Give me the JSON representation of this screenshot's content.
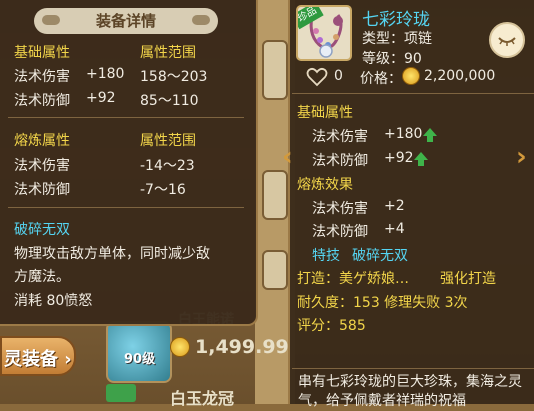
{
  "background": {
    "spirit_equip_button": "灵装备",
    "item_level": "90级",
    "item_price": "1,499.99",
    "item_name_partial": "白王能诺",
    "item_name2_partial": "白玉龙冠"
  },
  "left_panel": {
    "title": "装备详情",
    "base_header": "基础属性",
    "base_range_header": "属性范围",
    "base_attrs": [
      {
        "name": "法术伤害",
        "value": "+180",
        "range": "158～203"
      },
      {
        "name": "法术防御",
        "value": "+92",
        "range": "85～110"
      }
    ],
    "refine_header": "熔炼属性",
    "refine_range_header": "属性范围",
    "refine_attrs": [
      {
        "name": "法术伤害",
        "range": "-14～23"
      },
      {
        "name": "法术防御",
        "range": "-7～16"
      }
    ],
    "skill_name": "破碎无双",
    "skill_desc_line1": "物理攻击敌方单体，同时减少敌",
    "skill_desc_line2": "方魔法。",
    "skill_cost": "消耗 80愤怒"
  },
  "right_panel": {
    "tag": "珍品",
    "item_name": "七彩玲珑",
    "type": "类型：项链",
    "level": "等级：90",
    "likes": "0",
    "price": "价格：",
    "price_value": "2,200,000",
    "base_header": "基础属性",
    "base_attrs": [
      {
        "name": "法术伤害",
        "value": "+180"
      },
      {
        "name": "法术防御",
        "value": "+92"
      }
    ],
    "refine_header": "熔炼效果",
    "refine_attrs": [
      {
        "name": "法术伤害",
        "value": "+2"
      },
      {
        "name": "法术防御",
        "value": "+4"
      }
    ],
    "special_label": "特技",
    "special_value": "破碎无双",
    "forge": "打造：美ゲ娇娘…",
    "forge_enhance": "强化打造",
    "durability": "耐久度：153 修理失败 3次",
    "score": "评分：585",
    "description": "串有七彩玲珑的巨大珍珠，集海之灵气，给予佩戴者祥瑞的祝福"
  },
  "colors": {
    "header_yellow": "#f2d54a",
    "text_white": "#f1ece2",
    "skill_cyan": "#55d5f2",
    "panel_bg": "#3a2a1a",
    "up_green": "#3fb44a"
  },
  "icons": [
    "heart-icon",
    "coin-icon",
    "eye-closed-icon",
    "arrow-up-icon",
    "chevron-left-icon",
    "chevron-right-icon"
  ]
}
